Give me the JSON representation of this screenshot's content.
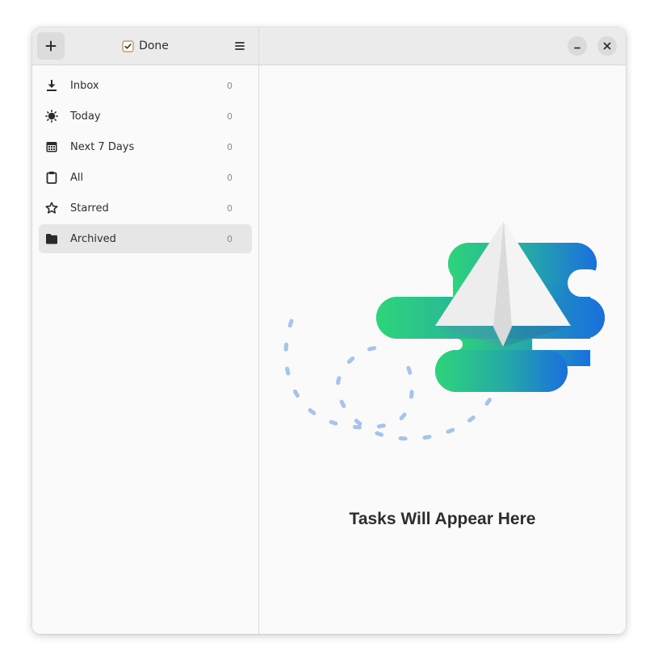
{
  "window": {
    "title": "Done"
  },
  "sidebar": {
    "add_button_icon": "plus-icon",
    "menu_button_icon": "hamburger-menu-icon",
    "items": [
      {
        "label": "Inbox",
        "count": "0",
        "icon": "download-tray-icon",
        "selected": false
      },
      {
        "label": "Today",
        "count": "0",
        "icon": "sun-icon",
        "selected": false
      },
      {
        "label": "Next 7 Days",
        "count": "0",
        "icon": "calendar-icon",
        "selected": false
      },
      {
        "label": "All",
        "count": "0",
        "icon": "clipboard-icon",
        "selected": false
      },
      {
        "label": "Starred",
        "count": "0",
        "icon": "star-icon",
        "selected": false
      },
      {
        "label": "Archived",
        "count": "0",
        "icon": "folder-icon",
        "selected": true
      }
    ]
  },
  "content": {
    "empty_state_title": "Tasks Will Appear Here",
    "illustration": "paper-plane-illustration"
  },
  "colors": {
    "accent_green": "#2ed47a",
    "accent_blue": "#1c6fdc",
    "selected_bg": "#e6e6e6",
    "header_bg": "#ebebeb"
  }
}
